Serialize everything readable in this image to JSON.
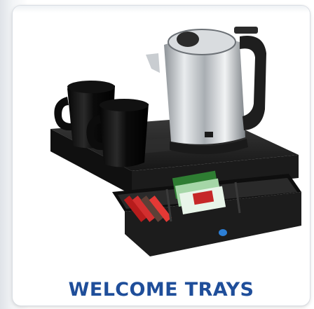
{
  "card": {
    "title": "WELCOME TRAYS",
    "image_subject": "welcome-tray-with-kettle-mugs-and-drawer"
  },
  "colors": {
    "title": "#1f4e9a",
    "tray": "#1e1e1e",
    "kettle_steel": "#cfd3d6",
    "drawer_knob": "#2c7fd6"
  }
}
